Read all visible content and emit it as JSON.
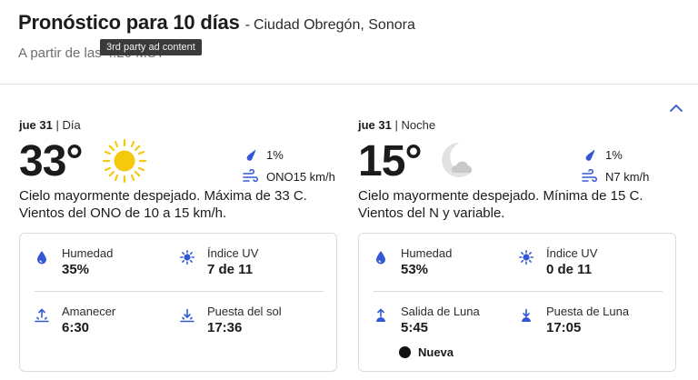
{
  "header": {
    "title": "Pronóstico para 10 días",
    "separator": "-",
    "location": "Ciudad Obregón, Sonora",
    "as_of": "A partir de las 4:20 MST",
    "tooltip": "3rd party ad content"
  },
  "colors": {
    "accent": "#3358d4",
    "sun": "#f5c90e",
    "moon": "#dcdcdc"
  },
  "day": {
    "date": "jue 31",
    "period": "| Día",
    "temp": "33°",
    "icon": "sun-icon",
    "precip": "1%",
    "wind": "ONO15 km/h",
    "narrative": "Cielo mayormente despejado. Máxima de 33 C. Vientos del ONO de 10 a 15 km/h.",
    "details": [
      {
        "label": "Humedad",
        "value": "35%",
        "icon": "humidity-icon"
      },
      {
        "label": "Índice UV",
        "value": "7 de 11",
        "icon": "uv-icon"
      },
      {
        "label": "Amanecer",
        "value": "6:30",
        "icon": "sunrise-icon"
      },
      {
        "label": "Puesta del sol",
        "value": "17:36",
        "icon": "sunset-icon"
      }
    ]
  },
  "night": {
    "date": "jue 31",
    "period": "| Noche",
    "temp": "15°",
    "icon": "moon-icon",
    "precip": "1%",
    "wind": "N7 km/h",
    "narrative": "Cielo mayormente despejado. Mínima de 15 C. Vientos del N y variable.",
    "details": [
      {
        "label": "Humedad",
        "value": "53%",
        "icon": "humidity-icon"
      },
      {
        "label": "Índice UV",
        "value": "0 de 11",
        "icon": "uv-icon"
      },
      {
        "label": "Salida de Luna",
        "value": "5:45",
        "icon": "moonrise-icon"
      },
      {
        "label": "Puesta de Luna",
        "value": "17:05",
        "icon": "moonset-icon"
      }
    ],
    "moon_phase": "Nueva"
  }
}
